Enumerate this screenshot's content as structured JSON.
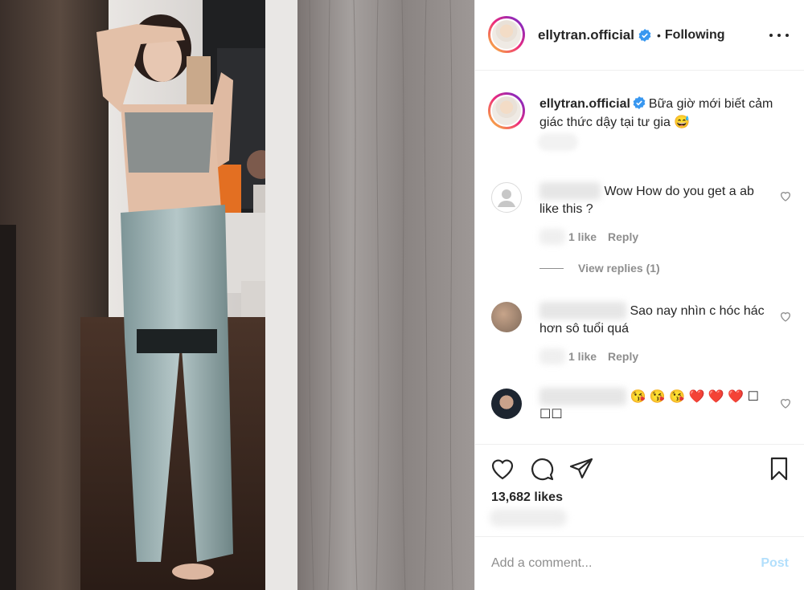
{
  "post": {
    "username": "ellytran.official",
    "separator": "•",
    "follow_status": "Following",
    "caption": "Bữa giờ mới biết cảm giác thức dậy tại tư gia 😅",
    "likes": "13,682 likes",
    "add_comment_placeholder": "Add a comment...",
    "post_label": "Post"
  },
  "comments": [
    {
      "text": "Wow How do you get a ab like this ?",
      "likes": "1 like",
      "reply": "Reply",
      "view_replies": "View replies (1)"
    },
    {
      "text": "Sao nay nhìn c hóc hác hơn sô tuổi quá",
      "likes": "1 like",
      "reply": "Reply"
    },
    {
      "text": "😘 😘 😘  ❤️ ❤️ ❤️ ☐ ☐☐"
    }
  ],
  "icons": {
    "verified": "verified-badge-icon",
    "like": "heart-icon",
    "comment": "comment-icon",
    "share": "send-icon",
    "save": "bookmark-icon",
    "more": "more-dots-icon"
  },
  "colors": {
    "verified_blue": "#3897f0",
    "text": "#262626",
    "secondary": "#8e8e8e",
    "post_disabled": "#b2dffc"
  }
}
